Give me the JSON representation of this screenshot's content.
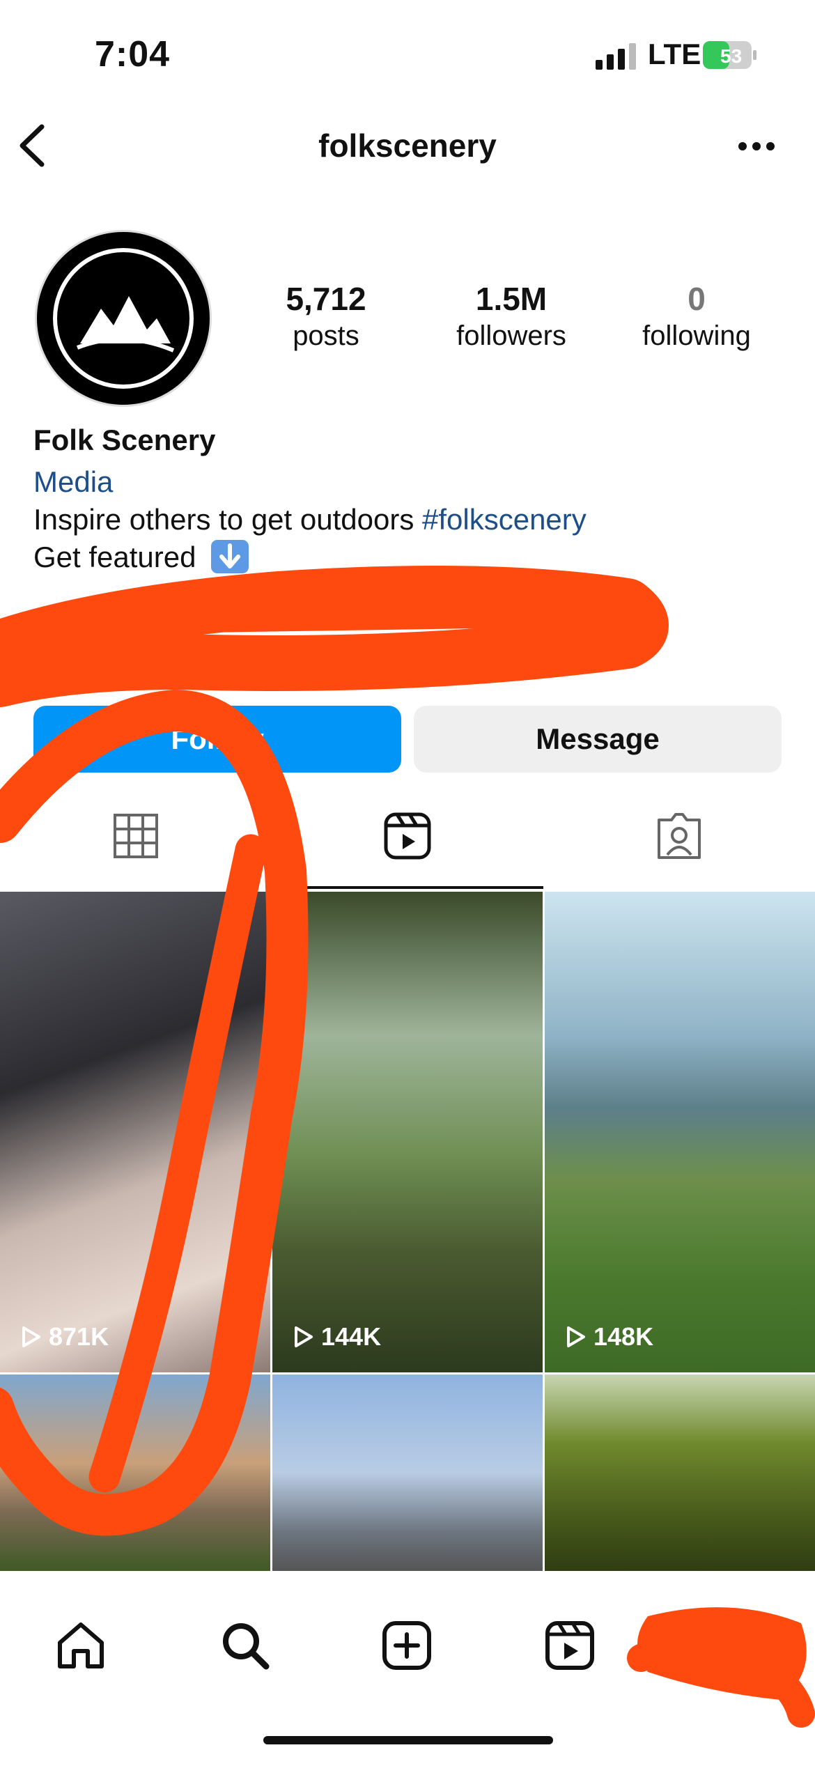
{
  "status_bar": {
    "time": "7:04",
    "network": "LTE",
    "battery": "53"
  },
  "header": {
    "username": "folkscenery"
  },
  "profile": {
    "stats": [
      {
        "value": "5,712",
        "label": "posts"
      },
      {
        "value": "1.5M",
        "label": "followers"
      },
      {
        "value": "0",
        "label": "following"
      }
    ],
    "name": "Folk Scenery",
    "category": "Media",
    "bio_text": "Inspire others to get outdoors ",
    "bio_hashtag": "#folkscenery",
    "bio_line2": "Get featured"
  },
  "actions": {
    "follow_label": "Follow",
    "message_label": "Message"
  },
  "tabs": [
    {
      "icon": "grid-icon",
      "active": false
    },
    {
      "icon": "reels-icon",
      "active": true
    },
    {
      "icon": "tagged-icon",
      "active": false
    }
  ],
  "grid": [
    {
      "views": "871K"
    },
    {
      "views": "144K"
    },
    {
      "views": "148K"
    },
    {
      "views": ""
    },
    {
      "views": ""
    },
    {
      "views": ""
    }
  ],
  "bottom_nav": [
    "home-icon",
    "search-icon",
    "create-icon",
    "reels-icon",
    "profile-icon"
  ],
  "colors": {
    "accent": "#0095f6",
    "link": "#1c4e8a",
    "scribble": "#ff4a0f"
  }
}
